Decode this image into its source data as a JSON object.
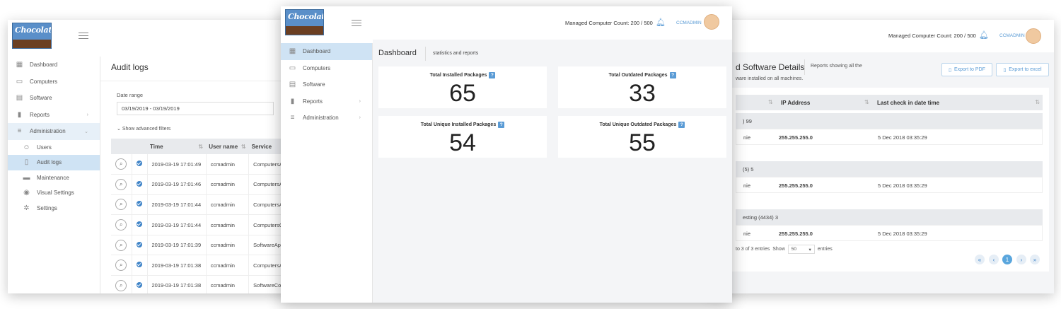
{
  "header": {
    "managed_count": "Managed Computer Count: 200 / 500",
    "user": "CCMADMIN",
    "logo_text": "Chocolatey"
  },
  "left_sidebar": {
    "items": [
      {
        "label": "Dashboard",
        "icon": "dashboard-icon"
      },
      {
        "label": "Computers",
        "icon": "monitor-icon"
      },
      {
        "label": "Software",
        "icon": "grid-icon"
      },
      {
        "label": "Reports",
        "icon": "report-icon"
      },
      {
        "label": "Administration",
        "icon": "sliders-icon"
      }
    ],
    "subitems": [
      {
        "label": "Users",
        "icon": "users-icon"
      },
      {
        "label": "Audit logs",
        "icon": "document-icon"
      },
      {
        "label": "Maintenance",
        "icon": "toolbox-icon"
      },
      {
        "label": "Visual Settings",
        "icon": "eye-icon"
      },
      {
        "label": "Settings",
        "icon": "gear-icon"
      }
    ]
  },
  "audit": {
    "title": "Audit logs",
    "date_range_label": "Date range",
    "date_range_value": "03/19/2019 - 03/19/2019",
    "advanced_filters": "Show advanced filters",
    "columns": [
      "Time",
      "User name",
      "Service"
    ],
    "rows": [
      {
        "time": "2019-03-19 17:01:49",
        "user": "ccmadmin",
        "service": "ComputersAp"
      },
      {
        "time": "2019-03-19 17:01:46",
        "user": "ccmadmin",
        "service": "ComputersAp"
      },
      {
        "time": "2019-03-19 17:01:44",
        "user": "ccmadmin",
        "service": "ComputersAp"
      },
      {
        "time": "2019-03-19 17:01:44",
        "user": "ccmadmin",
        "service": "ComputersCo"
      },
      {
        "time": "2019-03-19 17:01:39",
        "user": "ccmadmin",
        "service": "SoftwareApp"
      },
      {
        "time": "2019-03-19 17:01:38",
        "user": "ccmadmin",
        "service": "ComputersAp"
      },
      {
        "time": "2019-03-19 17:01:38",
        "user": "ccmadmin",
        "service": "SoftwareCon"
      }
    ]
  },
  "dashboard": {
    "title": "Dashboard",
    "subtitle": "statistics and reports",
    "nav": [
      {
        "label": "Dashboard",
        "icon": "dashboard-icon"
      },
      {
        "label": "Computers",
        "icon": "monitor-icon"
      },
      {
        "label": "Software",
        "icon": "grid-icon"
      },
      {
        "label": "Reports",
        "icon": "report-icon"
      },
      {
        "label": "Administration",
        "icon": "sliders-icon"
      }
    ],
    "cards": [
      {
        "label": "Total Installed Packages",
        "value": "65"
      },
      {
        "label": "Total Outdated Packages",
        "value": "33"
      },
      {
        "label": "Total Unique Installed Packages",
        "value": "54"
      },
      {
        "label": "Total Unique Outdated Packages",
        "value": "55"
      }
    ],
    "help": "?"
  },
  "software": {
    "title": "d Software Details",
    "desc_line1": "Reports showing all the",
    "desc_line2": "ware installed on all machines.",
    "export_pdf": "Export to PDF",
    "export_excel": "Export to excel",
    "columns": [
      "IP Address",
      "Last check in date time"
    ],
    "groups": [
      {
        "header": ") 99",
        "col1": "nie",
        "ip": "255.255.255.0",
        "date": "5 Dec 2018 03:35:29"
      },
      {
        "header": "(5) 5",
        "col1": "nie",
        "ip": "255.255.255.0",
        "date": "5 Dec 2018 03:35:29"
      },
      {
        "header": "esting (4434) 3",
        "col1": "nie",
        "ip": "255.255.255.0",
        "date": "5 Dec 2018 03:35:29"
      }
    ],
    "entries_info": "to 3 of 3 entries",
    "show_label": "Show",
    "page_size": "50",
    "entries_label": "entries",
    "pagination": [
      "«",
      "‹",
      "1",
      "›",
      "»"
    ]
  }
}
